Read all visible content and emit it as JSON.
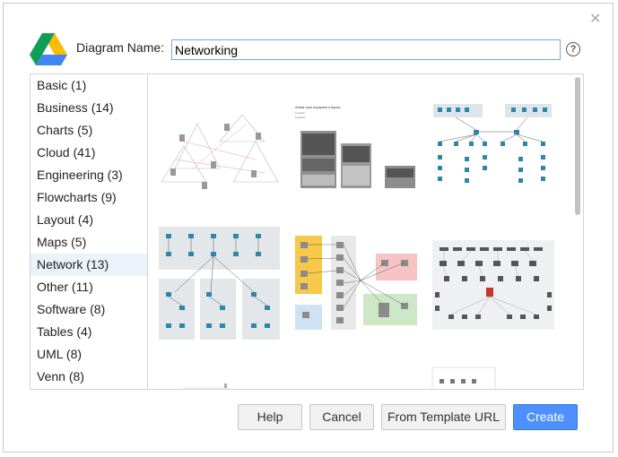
{
  "dialog": {
    "name_label": "Diagram Name:",
    "name_value": "Networking"
  },
  "categories": [
    {
      "label": "Basic (1)"
    },
    {
      "label": "Business (14)"
    },
    {
      "label": "Charts (5)"
    },
    {
      "label": "Cloud (41)"
    },
    {
      "label": "Engineering (3)"
    },
    {
      "label": "Flowcharts (9)"
    },
    {
      "label": "Layout (4)"
    },
    {
      "label": "Maps (5)"
    },
    {
      "label": "Network (13)",
      "selected": true
    },
    {
      "label": "Other (11)"
    },
    {
      "label": "Software (8)"
    },
    {
      "label": "Tables (4)"
    },
    {
      "label": "UML (8)"
    },
    {
      "label": "Venn (8)"
    }
  ],
  "thumbnails": {
    "rack_title": "Arista rack equipment layout",
    "rack_sub1": "Location",
    "rack_sub2": "Footprint"
  },
  "buttons": {
    "help": "Help",
    "cancel": "Cancel",
    "template_url": "From Template URL",
    "create": "Create"
  },
  "colors": {
    "accent": "#4d90fe",
    "selected_bg": "#ebf2f9"
  },
  "icons": [
    "close-icon",
    "drive-logo-icon",
    "help-icon"
  ]
}
